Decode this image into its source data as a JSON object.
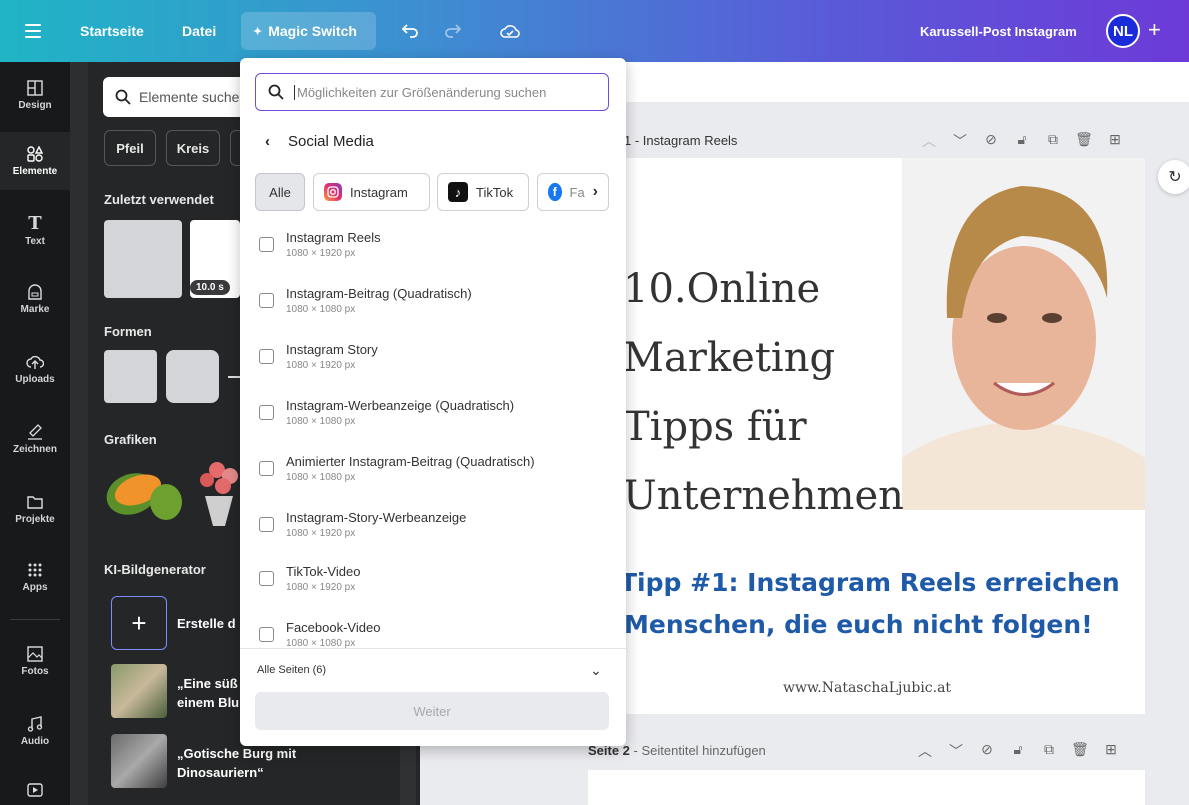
{
  "topbar": {
    "home": "Startseite",
    "file": "Datei",
    "magic": "Magic Switch",
    "doc_title": "Karussell-Post Instagram",
    "avatar": "NL"
  },
  "rail": [
    {
      "label": "Design",
      "icon": "layout-icon"
    },
    {
      "label": "Elemente",
      "icon": "shapes-icon"
    },
    {
      "label": "Text",
      "icon": "text-icon"
    },
    {
      "label": "Marke",
      "icon": "brand-icon"
    },
    {
      "label": "Uploads",
      "icon": "cloud-upload-icon"
    },
    {
      "label": "Zeichnen",
      "icon": "draw-icon"
    },
    {
      "label": "Projekte",
      "icon": "folder-icon"
    },
    {
      "label": "Apps",
      "icon": "apps-icon"
    },
    {
      "label": "Fotos",
      "icon": "photo-icon"
    },
    {
      "label": "Audio",
      "icon": "music-icon"
    }
  ],
  "panel": {
    "search_placeholder": "Elemente suche",
    "chips": [
      "Pfeil",
      "Kreis"
    ],
    "recent_title": "Zuletzt verwendet",
    "recent_badge": "10.0 s",
    "shapes_title": "Formen",
    "graphics_title": "Grafiken",
    "ki_title": "KI-Bildgenerator",
    "ki_create": "Erstelle d",
    "ki_item1_line1": "„Eine süß",
    "ki_item1_line2": "einem Blu",
    "ki_item2_line1": "„Gotische Burg mit",
    "ki_item2_line2": "Dinosauriern“"
  },
  "dropdown": {
    "search_placeholder": "Möglichkeiten zur Größenänderung suchen",
    "back_title": "Social Media",
    "chips": [
      "Alle",
      "Instagram",
      "TikTok",
      "Fa"
    ],
    "items": [
      {
        "name": "Instagram Reels",
        "size": "1080 × 1920 px"
      },
      {
        "name": "Instagram-Beitrag (Quadratisch)",
        "size": "1080 × 1080 px"
      },
      {
        "name": "Instagram Story",
        "size": "1080 × 1920 px"
      },
      {
        "name": "Instagram-Werbeanzeige (Quadratisch)",
        "size": "1080 × 1080 px"
      },
      {
        "name": "Animierter Instagram-Beitrag (Quadratisch)",
        "size": "1080 × 1080 px"
      },
      {
        "name": "Instagram-Story-Werbeanzeige",
        "size": "1080 × 1920 px"
      },
      {
        "name": "TikTok-Video",
        "size": "1080 × 1920 px"
      },
      {
        "name": "Facebook-Video",
        "size": "1080 × 1080 px"
      }
    ],
    "all_pages": "Alle Seiten (6)",
    "next": "Weiter"
  },
  "canvas": {
    "page1_label": "1 - Instagram Reels",
    "page2_label_bold": "Seite 2",
    "page2_label_rest": " - Seitentitel hinzufügen",
    "title_lines": [
      "10.Online",
      "Marketing",
      "Tipps für",
      "Unternehmen"
    ],
    "tipp_line1": "Tipp #1: Instagram Reels erreichen",
    "tipp_line2": "Menschen, die euch nicht folgen!",
    "url": "www.NataschaLjubic.at"
  },
  "colors": {
    "accent": "#6d4cdb",
    "tipp_blue": "#1f5aa8"
  }
}
